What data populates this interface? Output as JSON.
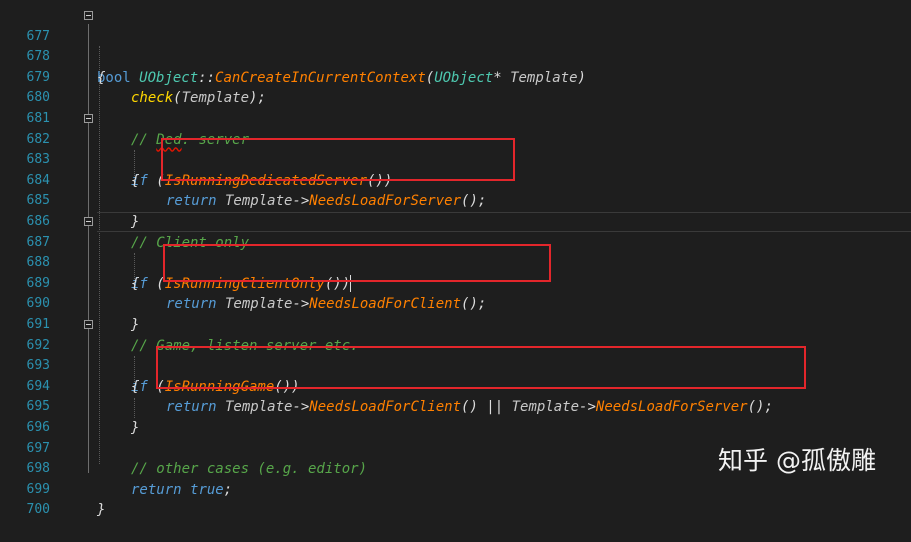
{
  "line_numbers": [
    "677",
    "678",
    "679",
    "680",
    "681",
    "682",
    "683",
    "684",
    "685",
    "686",
    "687",
    "688",
    "689",
    "690",
    "691",
    "692",
    "693",
    "694",
    "695",
    "696",
    "697",
    "698",
    "699",
    "700"
  ],
  "code": {
    "l677": {
      "kw": "bool",
      "cls": "UObject",
      "sep": "::",
      "fn": "CanCreateInCurrentContext",
      "open": "(",
      "type": "UObject",
      "ptr": "* ",
      "param": "Template",
      "close": ")"
    },
    "l678": {
      "brace": "{"
    },
    "l679": {
      "fn": "check",
      "open": "(",
      "arg": "Template",
      "close": ");"
    },
    "l681": {
      "cm_prefix": "// ",
      "cm_word": "Ded",
      "cm_rest": ". server"
    },
    "l682": {
      "kw": "if",
      "open": " (",
      "fn": "IsRunningDedicatedServer",
      "close": "())"
    },
    "l683": {
      "brace": "{"
    },
    "l684": {
      "kw": "return",
      "obj": " Template",
      "arrow": "->",
      "fn": "NeedsLoadForServer",
      "close": "();"
    },
    "l685": {
      "brace": "}"
    },
    "l686": {
      "cm": "// Client only"
    },
    "l687": {
      "kw": "if",
      "open": " (",
      "fn": "IsRunningClientOnly",
      "close": "())"
    },
    "l688": {
      "brace": "{"
    },
    "l689": {
      "kw": "return",
      "obj": " Template",
      "arrow": "->",
      "fn": "NeedsLoadForClient",
      "close": "();"
    },
    "l690": {
      "brace": "}"
    },
    "l691": {
      "cm": "// Game, listen server etc."
    },
    "l692": {
      "kw": "if",
      "open": " (",
      "fn": "IsRunningGame",
      "close": "())"
    },
    "l693": {
      "brace": "{"
    },
    "l694": {
      "kw": "return",
      "obj": " Template",
      "arrow": "->",
      "fn": "NeedsLoadForClient",
      "mid": "() || ",
      "obj2": "Template",
      "arrow2": "->",
      "fn2": "NeedsLoadForServer",
      "close": "();"
    },
    "l695": {
      "brace": "}"
    },
    "l697": {
      "cm": "// other cases (e.g. editor)"
    },
    "l698": {
      "kw": "return",
      "sp": " ",
      "val": "true",
      "close": ";"
    },
    "l699": {
      "brace": "}"
    }
  },
  "watermark": "知乎 @孤傲雕",
  "colors": {
    "background": "#1e1e1e",
    "line_number": "#2b91af",
    "keyword": "#569cd6",
    "function": "#ff8000",
    "type": "#4ec9b0",
    "comment": "#57a64a",
    "highlight_box": "#e3262b"
  }
}
